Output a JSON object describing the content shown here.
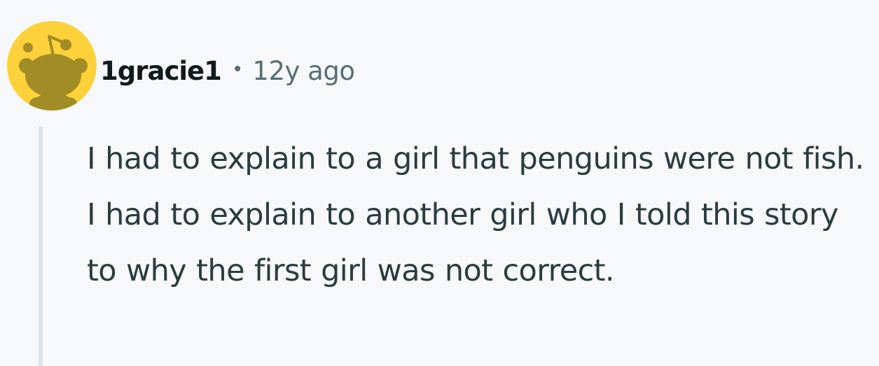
{
  "comment": {
    "author": "1gracie1",
    "separator": "•",
    "timestamp": "12y ago",
    "body": "I had to explain to a girl that penguins were not fish. I had to explain to another girl who I told this story to why the first girl was not correct.",
    "avatar": {
      "icon": "reddit-snoo-avatar-icon",
      "background_color": "#fcd13a",
      "figure_color": "#a18c26"
    }
  },
  "colors": {
    "page_background": "#f7f8fa",
    "username": "#0f1a1c",
    "meta_text": "#576f76",
    "body_text": "#2a3c42",
    "thread_line": "#dbe4e9"
  }
}
